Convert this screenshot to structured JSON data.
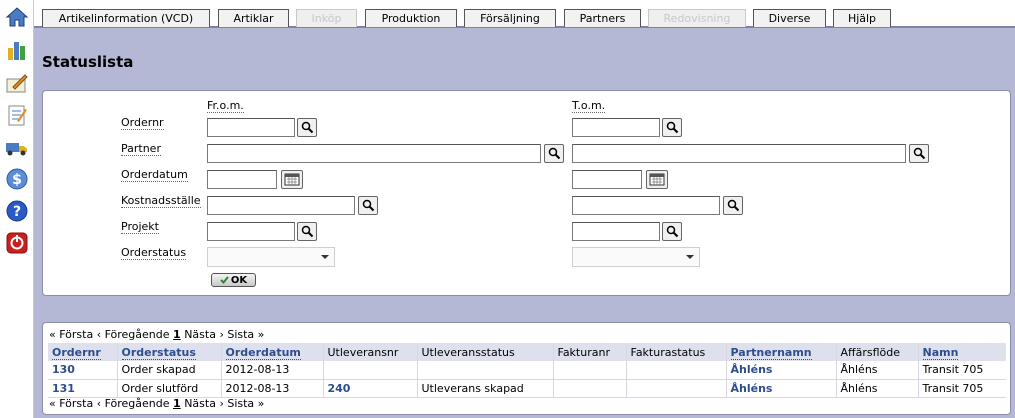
{
  "tabs": [
    {
      "label": "Artikelinformation (VCD)",
      "disabled": false
    },
    {
      "label": "Artiklar",
      "disabled": false
    },
    {
      "label": "Inköp",
      "disabled": true
    },
    {
      "label": "Produktion",
      "disabled": false
    },
    {
      "label": "Försäljning",
      "disabled": false
    },
    {
      "label": "Partners",
      "disabled": false
    },
    {
      "label": "Redovisning",
      "disabled": true
    },
    {
      "label": "Diverse",
      "disabled": false
    },
    {
      "label": "Hjälp",
      "disabled": false
    }
  ],
  "sidebar_icons": [
    "home-icon",
    "bar-chart-icon",
    "pencil-card-icon",
    "checklist-icon",
    "truck-icon",
    "dollar-icon",
    "help-icon",
    "power-icon"
  ],
  "page_title": "Statuslista",
  "filter": {
    "from_label": "Fr.o.m.",
    "to_label": "T.o.m.",
    "rows": [
      {
        "label": "Ordernr",
        "from_value": "",
        "to_value": ""
      },
      {
        "label": "Partner",
        "from_value": "",
        "to_value": ""
      },
      {
        "label": "Orderdatum",
        "from_value": "",
        "to_value": ""
      },
      {
        "label": "Kostnadsställe",
        "from_value": "",
        "to_value": ""
      },
      {
        "label": "Projekt",
        "from_value": "",
        "to_value": ""
      },
      {
        "label": "Orderstatus",
        "from_value": "",
        "to_value": ""
      }
    ],
    "ok_label": "OK"
  },
  "results": {
    "pager": {
      "first": "« Första",
      "prev": "‹ Föregående",
      "page": "1",
      "next": "Nästa ›",
      "last": "Sista »"
    },
    "columns": [
      "Ordernr",
      "Orderstatus",
      "Orderdatum",
      "Utleveransnr",
      "Utleveransstatus",
      "Fakturanr",
      "Fakturastatus",
      "Partnernamn",
      "Affärsflöde",
      "Namn"
    ],
    "rows": [
      [
        "130",
        "Order skapad",
        "2012-08-13",
        "",
        "",
        "",
        "",
        "Åhléns",
        "Åhléns",
        "Transit 705"
      ],
      [
        "131",
        "Order slutförd",
        "2012-08-13",
        "240",
        "Utleverans skapad",
        "",
        "",
        "Åhléns",
        "Åhléns",
        "Transit 705"
      ]
    ]
  },
  "colors": {
    "accent": "#2c4e8c",
    "background": "#b4b8d4",
    "header_row": "#dfe0ee"
  }
}
